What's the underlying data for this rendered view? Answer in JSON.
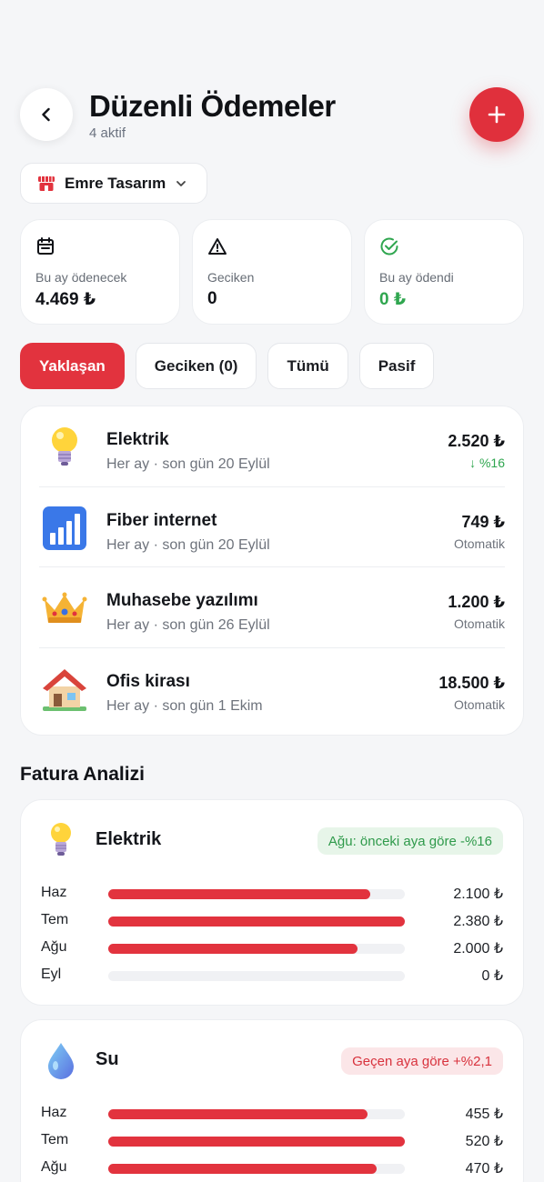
{
  "header": {
    "title": "Düzenli Ödemeler",
    "subtitle": "4 aktif"
  },
  "shop": {
    "name": "Emre Tasarım"
  },
  "stats": [
    {
      "icon": "calendar-icon",
      "label": "Bu ay ödenecek",
      "value": "4.469 ₺",
      "color": "#111318"
    },
    {
      "icon": "warning-icon",
      "label": "Geciken",
      "value": "0",
      "color": "#111318"
    },
    {
      "icon": "check-circle-icon",
      "label": "Bu ay ödendi",
      "value": "0 ₺",
      "color": "#2fa64f"
    }
  ],
  "filters": [
    {
      "label": "Yaklaşan",
      "active": true
    },
    {
      "label": "Geciken (0)",
      "active": false
    },
    {
      "label": "Tümü",
      "active": false
    },
    {
      "label": "Pasif",
      "active": false
    }
  ],
  "payments": [
    {
      "icon": "lightbulb-icon",
      "name": "Elektrik",
      "meta": "Her ay · son gün 20 Eylül",
      "amount": "2.520 ₺",
      "sub": "↓ %16"
    },
    {
      "icon": "signal-bars-icon",
      "name": "Fiber internet",
      "meta": "Her ay · son gün 20 Eylül",
      "amount": "749 ₺",
      "sub": "Otomatik"
    },
    {
      "icon": "crown-icon",
      "name": "Muhasebe yazılımı",
      "meta": "Her ay · son gün 26 Eylül",
      "amount": "1.200 ₺",
      "sub": "Otomatik"
    },
    {
      "icon": "house-icon",
      "name": "Ofis kirası",
      "meta": "Her ay · son gün 1 Ekim",
      "amount": "18.500 ₺",
      "sub": "Otomatik"
    }
  ],
  "analysis": {
    "title": "Fatura Analizi",
    "cards": [
      {
        "icon": "lightbulb-icon",
        "name": "Elektrik",
        "badge": "Ağu: önceki aya göre -%16",
        "bars": [
          {
            "month": "Haz",
            "value": "2.100 ₺",
            "fraction": 0.882
          },
          {
            "month": "Tem",
            "value": "2.380 ₺",
            "fraction": 1.0
          },
          {
            "month": "Ağu",
            "value": "2.000 ₺",
            "fraction": 0.84
          },
          {
            "month": "Eyl",
            "value": "0 ₺",
            "fraction": 0
          }
        ]
      },
      {
        "icon": "water-drop-icon",
        "name": "Su",
        "badge": "Geçen aya göre +%2,1",
        "bars": [
          {
            "month": "Haz",
            "value": "455 ₺",
            "fraction": 0.875
          },
          {
            "month": "Tem",
            "value": "520 ₺",
            "fraction": 1.0
          },
          {
            "month": "Ağu",
            "value": "470 ₺",
            "fraction": 0.904
          }
        ]
      }
    ]
  }
}
